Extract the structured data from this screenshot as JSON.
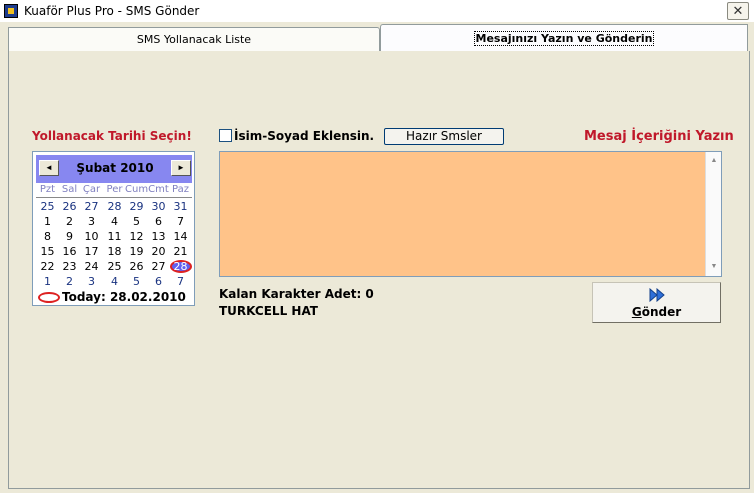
{
  "window": {
    "title": "Kuaför Plus Pro - SMS Gönder",
    "close_glyph": "✕"
  },
  "tabs": [
    {
      "label": "SMS Yollanacak Liste"
    },
    {
      "label": "Mesajınızı Yazın ve Gönderin"
    }
  ],
  "date_section": {
    "label": "Yollanacak Tarihi Seçin!"
  },
  "calendar": {
    "month_label": "Şubat 2010",
    "prev_glyph": "◄",
    "next_glyph": "►",
    "days_of_week": [
      "Pzt",
      "Sal",
      "Çar",
      "Per",
      "Cum",
      "Cmt",
      "Paz"
    ],
    "weeks": [
      [
        "25",
        "26",
        "27",
        "28",
        "29",
        "30",
        "31"
      ],
      [
        "1",
        "2",
        "3",
        "4",
        "5",
        "6",
        "7"
      ],
      [
        "8",
        "9",
        "10",
        "11",
        "12",
        "13",
        "14"
      ],
      [
        "15",
        "16",
        "17",
        "18",
        "19",
        "20",
        "21"
      ],
      [
        "22",
        "23",
        "24",
        "25",
        "26",
        "27",
        "28"
      ],
      [
        "1",
        "2",
        "3",
        "4",
        "5",
        "6",
        "7"
      ]
    ],
    "selected_day": "28",
    "today_label": "Today: 28.02.2010"
  },
  "options": {
    "add_name_label": "İsim-Soyad Eklensin.",
    "ready_sms_button": "Hazır Smsler"
  },
  "message": {
    "label": "Mesaj İçeriğini Yazın",
    "value": "",
    "scroll_up": "▲",
    "scroll_down": "▼"
  },
  "status": {
    "remaining_chars": "Kalan Karakter Adet: 0",
    "line": "TURKCELL HAT"
  },
  "send_button": {
    "mnemonic": "G",
    "rest": "önder"
  },
  "colors": {
    "accent_red": "#c0182a",
    "message_bg": "#ffc389",
    "calendar_header": "#8787f0"
  }
}
